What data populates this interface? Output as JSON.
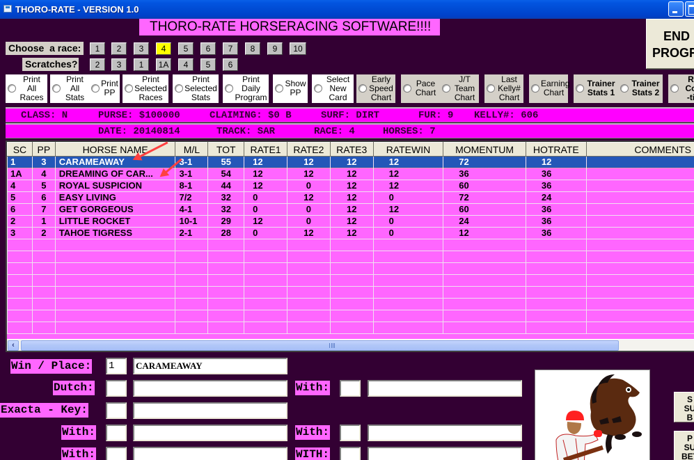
{
  "window": {
    "title": "THORO-RATE - VERSION 1.0",
    "app_icon": "app-window-icon",
    "controls": [
      "minimize",
      "maximize"
    ]
  },
  "banner": "THORO-RATE HORSERACING SOFTWARE!!!!",
  "end_button": "END\nPROGRAM",
  "race_chooser": {
    "label": "Choose  a race:",
    "races": [
      "1",
      "2",
      "3",
      "4",
      "5",
      "6",
      "7",
      "8",
      "9",
      "10"
    ],
    "selected": "4"
  },
  "scratches": {
    "label": "Scratches?",
    "items": [
      "2",
      "3",
      "1",
      "1A",
      "4",
      "5",
      "6"
    ]
  },
  "options": [
    {
      "label": "Print\nAll\nRaces",
      "style": "white"
    },
    {
      "label": "Print\nAll\nStats",
      "style": "white"
    },
    {
      "label": "Print\nPP",
      "style": "white"
    },
    {
      "label": "Print\nSelected\nRaces",
      "style": "white"
    },
    {
      "label": "Print\nSelected\nStats",
      "style": "white"
    },
    {
      "label": "Print\nDaily\nProgram",
      "style": "white"
    },
    {
      "label": "Show\nPP",
      "style": "white"
    },
    {
      "label": "Select\nNew\nCard",
      "style": "white"
    },
    {
      "label": "Early\nSpeed\nChart",
      "style": "gray"
    },
    {
      "label": "Pace\nChart",
      "style": "gray"
    },
    {
      "label": "J/T\nTeam\nChart",
      "style": "gray"
    },
    {
      "label": "Last\nKelly#\nChart",
      "style": "gray"
    },
    {
      "label": "Earning\nChart",
      "style": "gray"
    },
    {
      "label": "Trainer\nStats 1",
      "style": "gray-bold"
    },
    {
      "label": "Trainer\nStats 2",
      "style": "gray-bold"
    },
    {
      "label": "R\nCo\n-ti",
      "style": "gray-bold"
    }
  ],
  "race_info": {
    "class": "CLASS: N",
    "purse": "PURSE: $100000",
    "claiming": "CLAIMING: $0 B",
    "surface": "SURF: DIRT",
    "furlongs": "FUR: 9",
    "kelly": "KELLY#: 606",
    "date": "DATE: 20140814",
    "track": "TRACK: SAR",
    "race": "RACE: 4",
    "horses": "HORSES: 7"
  },
  "grid": {
    "columns": [
      "SC",
      "PP",
      "HORSE NAME",
      "M/L",
      "TOT",
      "RATE1",
      "RATE2",
      "RATE3",
      "RATEWIN",
      "MOMENTUM",
      "HOTRATE",
      "COMMENTS"
    ],
    "rows": [
      {
        "sc": "1",
        "pp": "3",
        "name": "CARAMEAWAY",
        "ml": "3-1",
        "tot": "55",
        "rate1": "12",
        "rate2": "12",
        "rate3": "12",
        "ratewin": "12",
        "momentum": "72",
        "hotrate": "12",
        "comments": "",
        "selected": true
      },
      {
        "sc": "1A",
        "pp": "4",
        "name": "DREAMING OF CAR...",
        "ml": "3-1",
        "tot": "54",
        "rate1": "12",
        "rate2": "12",
        "rate3": "12",
        "ratewin": "12",
        "momentum": "36",
        "hotrate": "36",
        "comments": ""
      },
      {
        "sc": "4",
        "pp": "5",
        "name": "ROYAL SUSPICION",
        "ml": "8-1",
        "tot": "44",
        "rate1": "12",
        "rate2": "0",
        "rate3": "12",
        "ratewin": "12",
        "momentum": "60",
        "hotrate": "36",
        "comments": ""
      },
      {
        "sc": "5",
        "pp": "6",
        "name": "EASY LIVING",
        "ml": "7/2",
        "tot": "32",
        "rate1": "0",
        "rate2": "12",
        "rate3": "12",
        "ratewin": "0",
        "momentum": "72",
        "hotrate": "24",
        "comments": ""
      },
      {
        "sc": "6",
        "pp": "7",
        "name": "GET GORGEOUS",
        "ml": "4-1",
        "tot": "32",
        "rate1": "0",
        "rate2": "0",
        "rate3": "12",
        "ratewin": "12",
        "momentum": "60",
        "hotrate": "36",
        "comments": ""
      },
      {
        "sc": "2",
        "pp": "1",
        "name": "LITTLE ROCKET",
        "ml": "10-1",
        "tot": "29",
        "rate1": "12",
        "rate2": "0",
        "rate3": "12",
        "ratewin": "0",
        "momentum": "24",
        "hotrate": "36",
        "comments": ""
      },
      {
        "sc": "3",
        "pp": "2",
        "name": "TAHOE TIGRESS",
        "ml": "2-1",
        "tot": "28",
        "rate1": "0",
        "rate2": "12",
        "rate3": "12",
        "ratewin": "0",
        "momentum": "12",
        "hotrate": "36",
        "comments": ""
      }
    ],
    "empty_rows": 8
  },
  "bets": {
    "win_place": {
      "label": "Win / Place:",
      "num": "1",
      "name": "CARAMEAWAY"
    },
    "dutch": {
      "label": "Dutch:",
      "num": "",
      "name": "",
      "with_label": "With:",
      "with_num": "",
      "with_name": ""
    },
    "exacta_key": {
      "label": "Exacta - Key:",
      "num": "",
      "name": ""
    },
    "with1": {
      "label": "With:",
      "num": "",
      "name": "",
      "with_label": "With:",
      "with_num": "",
      "with_name": ""
    },
    "with2": {
      "label": "With:",
      "num": "",
      "name": "",
      "with_label": "WITH:",
      "with_num": "",
      "with_name": ""
    }
  },
  "side_buttons": [
    "S\nSU\nB",
    "P\nSU\nBET"
  ],
  "colors": {
    "background": "#330033",
    "grid_row": "#ff66ff",
    "info_bar": "#ff00ff",
    "selected_row": "#2457b8",
    "selected_race": "#ffff00",
    "annotation_arrow": "#ff4040"
  }
}
